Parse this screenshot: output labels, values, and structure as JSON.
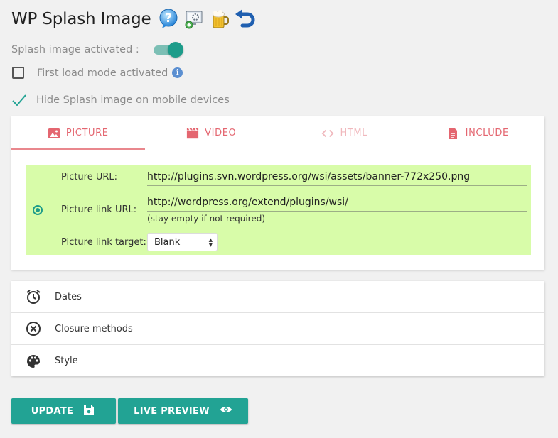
{
  "header": {
    "title": "WP Splash Image",
    "icons": [
      "help-icon",
      "settings-icon",
      "beer-icon",
      "undo-icon"
    ]
  },
  "options": {
    "splash_activated_label": "Splash image activated :",
    "splash_activated": true,
    "first_load_label": "First load mode activated",
    "first_load_checked": false,
    "hide_mobile_label": "Hide Splash image on mobile devices",
    "hide_mobile_checked": true
  },
  "tabs": [
    {
      "label": "Picture",
      "icon": "image-icon",
      "active": true
    },
    {
      "label": "Video",
      "icon": "video-icon",
      "active": false
    },
    {
      "label": "HTML",
      "icon": "code-icon",
      "active": false,
      "disabled": true
    },
    {
      "label": "Include",
      "icon": "file-icon",
      "active": false
    }
  ],
  "picture": {
    "url_label": "Picture URL:",
    "url_value": "http://plugins.svn.wordpress.org/wsi/assets/banner-772x250.png",
    "link_label": "Picture link URL:",
    "link_value": "http://wordpress.org/extend/plugins/wsi/",
    "link_hint": "(stay empty if not required)",
    "target_label": "Picture link target:",
    "target_value": "Blank"
  },
  "accordion": [
    {
      "label": "Dates",
      "icon": "alarm-clock-icon"
    },
    {
      "label": "Closure methods",
      "icon": "close-circle-icon"
    },
    {
      "label": "Style",
      "icon": "palette-icon"
    }
  ],
  "buttons": {
    "update_label": "Update",
    "preview_label": "Live preview"
  },
  "colors": {
    "accent": "#22a394",
    "tab_text": "#e46670",
    "panel_bg": "#d8fca9"
  }
}
